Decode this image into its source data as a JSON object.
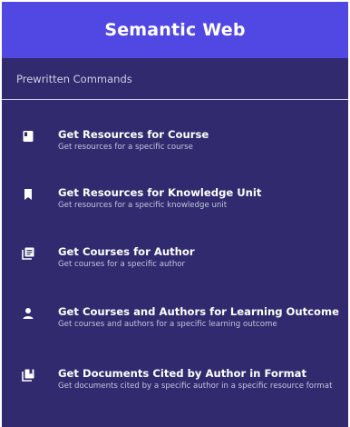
{
  "header": {
    "title": "Semantic Web"
  },
  "section": {
    "label": "Prewritten Commands"
  },
  "commands": [
    {
      "icon": "book-icon",
      "title": "Get Resources for Course",
      "subtitle": "Get resources for a specific course"
    },
    {
      "icon": "bookmark-icon",
      "title": "Get Resources for Knowledge Unit",
      "subtitle": "Get resources for a specific knowledge unit"
    },
    {
      "icon": "library-books-icon",
      "title": "Get Courses for Author",
      "subtitle": "Get courses for a specific author"
    },
    {
      "icon": "person-icon",
      "title": "Get Courses and Authors for Learning Outcome",
      "subtitle": "Get courses and authors for a specific learning outcome"
    },
    {
      "icon": "collections-bookmark-icon",
      "title": "Get Documents Cited by Author in Format",
      "subtitle": "Get documents cited by a specific author in a specific resource format"
    }
  ],
  "colors": {
    "header_bg": "#5148e4",
    "panel_bg": "#312a6e",
    "text_primary": "#ffffff",
    "text_secondary": "#c4c4dc",
    "divider": "#cfd0e6"
  }
}
